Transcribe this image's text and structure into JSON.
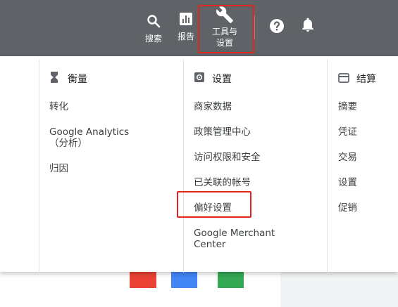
{
  "toolbar": {
    "search_label": "搜索",
    "reports_label": "报告",
    "tools_label_line1": "工具与",
    "tools_label_line2": "设置"
  },
  "menu": {
    "columns": [
      {
        "heading": "衡量",
        "icon": "hourglass-icon",
        "items": [
          "转化",
          "Google Analytics（分析）",
          "归因"
        ]
      },
      {
        "heading": "设置",
        "icon": "gear-icon",
        "items": [
          "商家数据",
          "政策管理中心",
          "访问权限和安全",
          "已关联的帐号",
          "偏好设置",
          "Google Merchant Center"
        ]
      },
      {
        "heading": "结算",
        "icon": "credit-card-icon",
        "items": [
          "摘要",
          "凭证",
          "交易",
          "设置",
          "促销"
        ]
      }
    ]
  },
  "colors": {
    "topbar": "#5f6368",
    "highlight": "#e1261c",
    "google_red": "#ea4335",
    "google_blue": "#4285f4",
    "google_green": "#34a853"
  }
}
